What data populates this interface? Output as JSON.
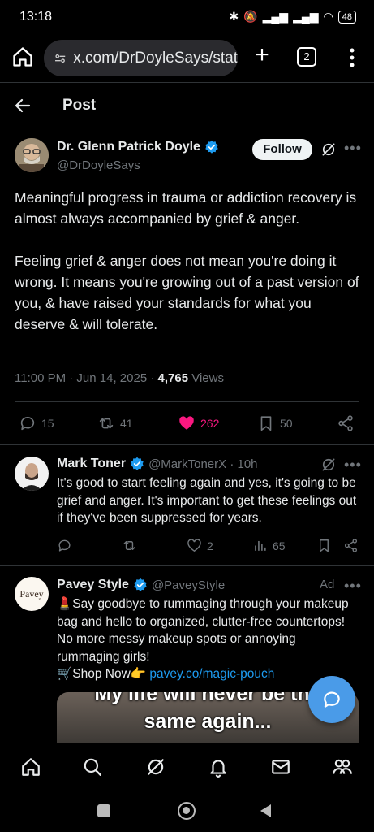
{
  "status_bar": {
    "time": "13:18",
    "battery": "48"
  },
  "browser": {
    "url": "x.com/DrDoyleSays/stat",
    "tab_count": "2"
  },
  "header": {
    "title": "Post"
  },
  "main_post": {
    "author_name": "Dr. Glenn Patrick Doyle",
    "handle": "@DrDoyleSays",
    "follow_label": "Follow",
    "paragraph1": "Meaningful progress in trauma or addiction recovery is almost always accompanied by grief & anger.",
    "paragraph2": "Feeling grief & anger does not mean you're doing it wrong. It means you're growing out of a past version of you, & have raised your standards for what you deserve & will tolerate.",
    "timestamp": "11:00 PM · Jun 14, 2025 · ",
    "views_count": "4,765",
    "views_label": " Views",
    "replies": "15",
    "reposts": "41",
    "likes": "262",
    "bookmarks": "50"
  },
  "reply": {
    "author_name": "Mark Toner",
    "handle": "@MarkTonerX · 10h",
    "text": "It's good to start feeling again and yes, it's going to be grief and anger. It's important to get these feelings out if they've been suppressed for years.",
    "likes": "2",
    "views": "65"
  },
  "ad": {
    "author_name": "Pavey Style",
    "handle": "@PaveyStyle",
    "ad_label": "Ad",
    "avatar_text": "Pavey",
    "line1": "💄Say goodbye to rummaging through your makeup bag and hello to organized, clutter-free countertops! No more messy makeup spots or annoying rummaging girls!",
    "shop_label": "🛒Shop Now👉 ",
    "link": "pavey.co/magic-pouch",
    "media_line1": "My life will never be the",
    "media_line2": "same again..."
  },
  "colors": {
    "like_pink": "#f91880",
    "link_blue": "#1d9bf0",
    "verified_blue": "#1d9bf0"
  }
}
